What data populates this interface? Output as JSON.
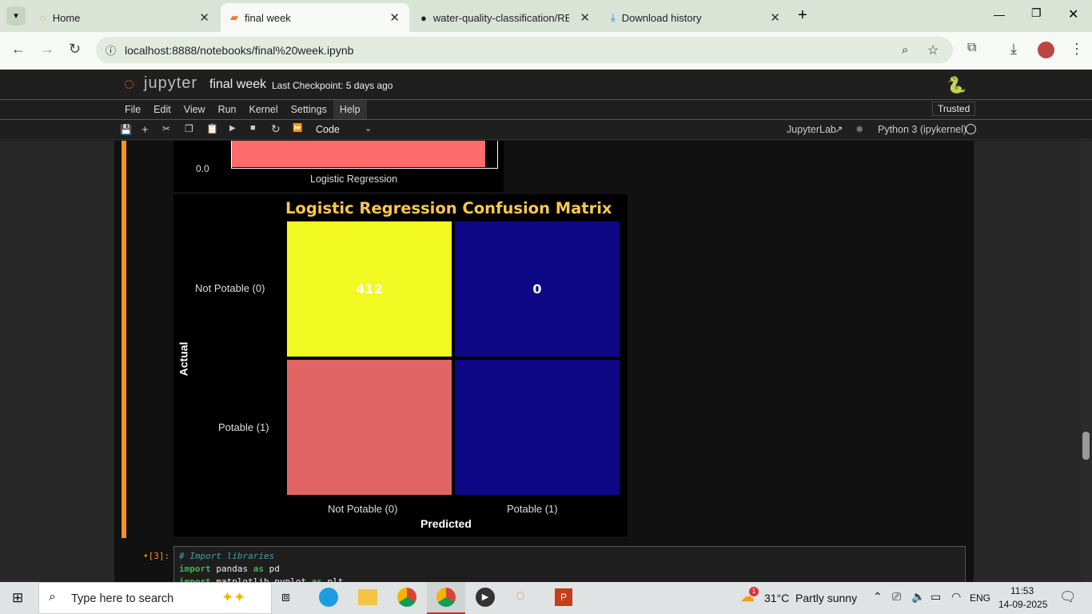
{
  "browser": {
    "tabs": [
      {
        "label": "Home",
        "icon": "jupyter-icon"
      },
      {
        "label": "final week",
        "icon": "jupyter-notebook-icon",
        "active": true
      },
      {
        "label": "water-quality-classification/REA",
        "icon": "github-icon"
      },
      {
        "label": "Download history",
        "icon": "download-icon"
      }
    ],
    "url": "localhost:8888/notebooks/final%20week.ipynb"
  },
  "jupyter": {
    "logo_text": "jupyter",
    "notebook_title": "final week",
    "checkpoint": "Last Checkpoint: 5 days ago",
    "menu": [
      "File",
      "Edit",
      "View",
      "Run",
      "Kernel",
      "Settings",
      "Help"
    ],
    "trusted": "Trusted",
    "cell_type": "Code",
    "jupyterlab_link": "JupyterLab",
    "kernel": "Python 3 (ipykernel)"
  },
  "chart_data": [
    {
      "type": "bar",
      "categories": [
        "Logistic Regression"
      ],
      "y_ticks": [
        "0.0"
      ],
      "colors": [
        "#ff6b6b"
      ],
      "partial": true
    },
    {
      "type": "heatmap",
      "title": "Logistic Regression Confusion Matrix",
      "xlabel": "Predicted",
      "ylabel": "Actual",
      "x_categories": [
        "Not Potable (0)",
        "Potable (1)"
      ],
      "y_categories": [
        "Not Potable (0)",
        "Potable (1)"
      ],
      "values": [
        [
          412,
          0
        ],
        [
          null,
          null
        ]
      ],
      "cell_colors": [
        [
          "#f2f922",
          "#0e0786"
        ],
        [
          "#e06463",
          "#0e0786"
        ]
      ],
      "title_color": "#f9c74f"
    }
  ],
  "code_cell": {
    "prompt": "•[3]:",
    "lines": [
      [
        {
          "t": "# Import libraries",
          "c": "cm"
        }
      ],
      [
        {
          "t": "import",
          "c": "kw"
        },
        {
          "t": " pandas ",
          "c": "tx"
        },
        {
          "t": "as",
          "c": "kw"
        },
        {
          "t": " pd",
          "c": "tx"
        }
      ],
      [
        {
          "t": "import",
          "c": "kw"
        },
        {
          "t": " matplotlib.pyplot ",
          "c": "tx"
        },
        {
          "t": "as",
          "c": "kw"
        },
        {
          "t": " plt",
          "c": "tx"
        }
      ]
    ]
  },
  "taskbar": {
    "search_placeholder": "Type here to search",
    "weather": "31°C  Partly sunny",
    "weather_badge": "1",
    "lang": "ENG",
    "time": "11:53",
    "date": "14-09-2025"
  }
}
